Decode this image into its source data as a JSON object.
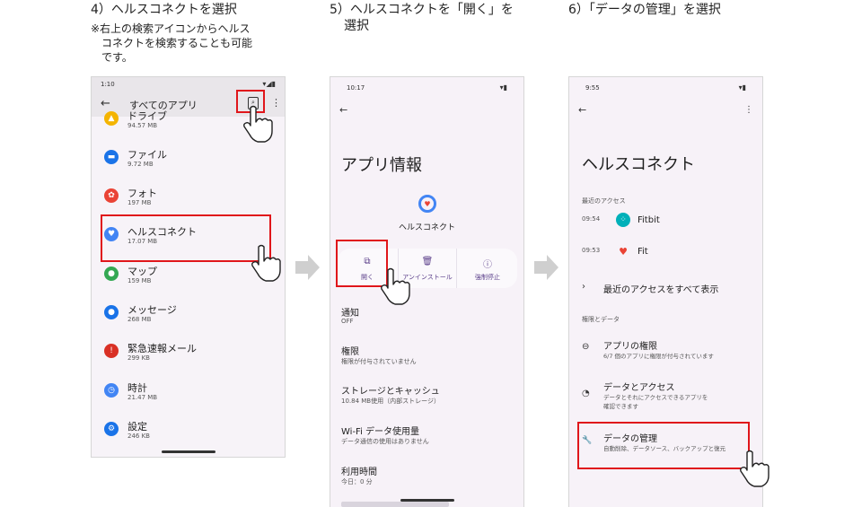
{
  "steps": {
    "step4": {
      "caption": "4）ヘルスコネクトを選択",
      "note_line1": "※右上の検索アイコンからヘルス",
      "note_line2": "コネクトを検索することも可能",
      "note_line3": "です。"
    },
    "step5": {
      "caption_line1": "5）ヘルスコネクトを「開く」を",
      "caption_line2": "選択"
    },
    "step6": {
      "caption": "6）「データの管理」を選択"
    }
  },
  "phone1": {
    "status_time": "1:10",
    "title": "すべてのアプリ",
    "apps": [
      {
        "name": "ドライブ",
        "size": "94.57 MB",
        "color": "#f4b400",
        "glyph": "▲"
      },
      {
        "name": "ファイル",
        "size": "9.72 MB",
        "color": "#1a73e8",
        "glyph": "▬"
      },
      {
        "name": "フォト",
        "size": "197 MB",
        "color": "#ea4335",
        "glyph": "✿"
      },
      {
        "name": "ヘルスコネクト",
        "size": "17.07 MB",
        "color": "#4285f4",
        "glyph": "♥"
      },
      {
        "name": "マップ",
        "size": "159 MB",
        "color": "#34a853",
        "glyph": "●"
      },
      {
        "name": "メッセージ",
        "size": "268 MB",
        "color": "#1a73e8",
        "glyph": "●"
      },
      {
        "name": "緊急速報メール",
        "size": "299 KB",
        "color": "#d93025",
        "glyph": "!"
      },
      {
        "name": "時計",
        "size": "21.47 MB",
        "color": "#4285f4",
        "glyph": "◷"
      },
      {
        "name": "設定",
        "size": "246 KB",
        "color": "#1a73e8",
        "glyph": "⚙"
      }
    ]
  },
  "phone2": {
    "status_time": "10:17",
    "title": "アプリ情報",
    "app_name": "ヘルスコネクト",
    "actions": [
      {
        "label": "開く",
        "glyph": "⧉"
      },
      {
        "label": "アンインストール",
        "glyph": "🗑"
      },
      {
        "label": "強制停止",
        "glyph": "ⓘ"
      }
    ],
    "rows": [
      {
        "title": "通知",
        "sub": "OFF"
      },
      {
        "title": "権限",
        "sub": "権限が付与されていません"
      },
      {
        "title": "ストレージとキャッシュ",
        "sub": "10.84 MB使用（内部ストレージ）"
      },
      {
        "title": "Wi-Fi データ使用量",
        "sub": "データ通信の使用はありません"
      },
      {
        "title": "利用時間",
        "sub": "今日：0 分"
      }
    ]
  },
  "phone3": {
    "status_time": "9:55",
    "title": "ヘルスコネクト",
    "recent_label": "最近のアクセス",
    "recent": [
      {
        "time": "09:54",
        "name": "Fitbit",
        "color": "#00b0b9"
      },
      {
        "time": "09:53",
        "name": "Fit",
        "color": "#ea4335"
      }
    ],
    "see_all": "最近のアクセスをすべて表示",
    "perm_label": "権限とデータ",
    "rows": [
      {
        "title": "アプリの権限",
        "sub": "6/7 個のアプリに権限が付与されています",
        "glyph": "⊖"
      },
      {
        "title": "データとアクセス",
        "sub": "データとそれにアクセスできるアプリを確認できます",
        "glyph": "◔"
      },
      {
        "title": "データの管理",
        "sub": "自動削除、データソース、バックアップと復元",
        "glyph": "🔧"
      }
    ]
  }
}
